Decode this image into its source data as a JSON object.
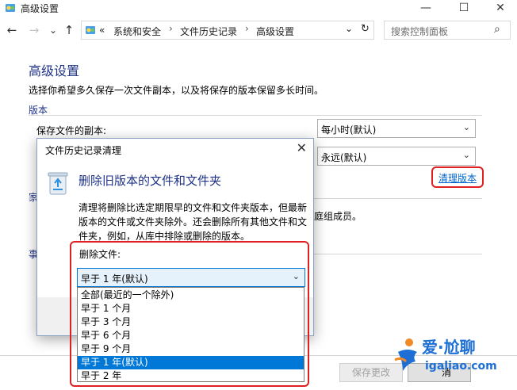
{
  "window": {
    "title": "高级设置",
    "minimize": "—",
    "maximize": "☐",
    "close": "✕"
  },
  "nav": {
    "back": "←",
    "forward": "→",
    "recent": "⌄",
    "up": "↑",
    "overflow": "«",
    "breadcrumbs": [
      "系统和安全",
      "文件历史记录",
      "高级设置"
    ],
    "breadcrumb_sep": "›",
    "dropdown": "⌄",
    "refresh": "↻",
    "search_placeholder": "搜索控制面板",
    "search_icon": "⌕"
  },
  "page": {
    "heading": "高级设置",
    "description": "选择你希望多久保存一次文件副本，以及将保存的版本保留多长时间。",
    "section_versions": "版本",
    "save_copies_label": "保存文件的副本:",
    "save_copies_value": "每小时(默认)",
    "keep_versions_value": "永远(默认)",
    "cleanup_link": "清理版本",
    "partial_section_1": "家",
    "partial_text_homegroup": "庭组成员。",
    "partial_section_2": "事",
    "save_changes_button": "保存更改",
    "cancel_button": "取消",
    "cancel_partial": "消"
  },
  "dialog": {
    "title": "文件历史记录清理",
    "close": "✕",
    "heading": "删除旧版本的文件和文件夹",
    "body": "清理将删除比选定期限早的文件和文件夹版本，但最新版本的文件或文件夹除外。还会删除所有其他文件和文件夹，例如，从库中排除或删除的版本。",
    "delete_files_label": "删除文件:",
    "selected_value": "早于 1 年(默认)",
    "options": [
      "全部(最近的一个除外)",
      "早于 1 个月",
      "早于 3 个月",
      "早于 6 个月",
      "早于 9 个月",
      "早于 1 年(默认)",
      "早于 2 年"
    ],
    "selected_index": 5
  },
  "watermark": {
    "brand": "爱·尬聊",
    "url": "igaliao.com"
  },
  "icons": {
    "app": "control-panel-icon",
    "dialog": "recycle-bin-icon",
    "chevron": "⌄",
    "accent": "#0078d7",
    "highlight_border": "#e02020"
  }
}
